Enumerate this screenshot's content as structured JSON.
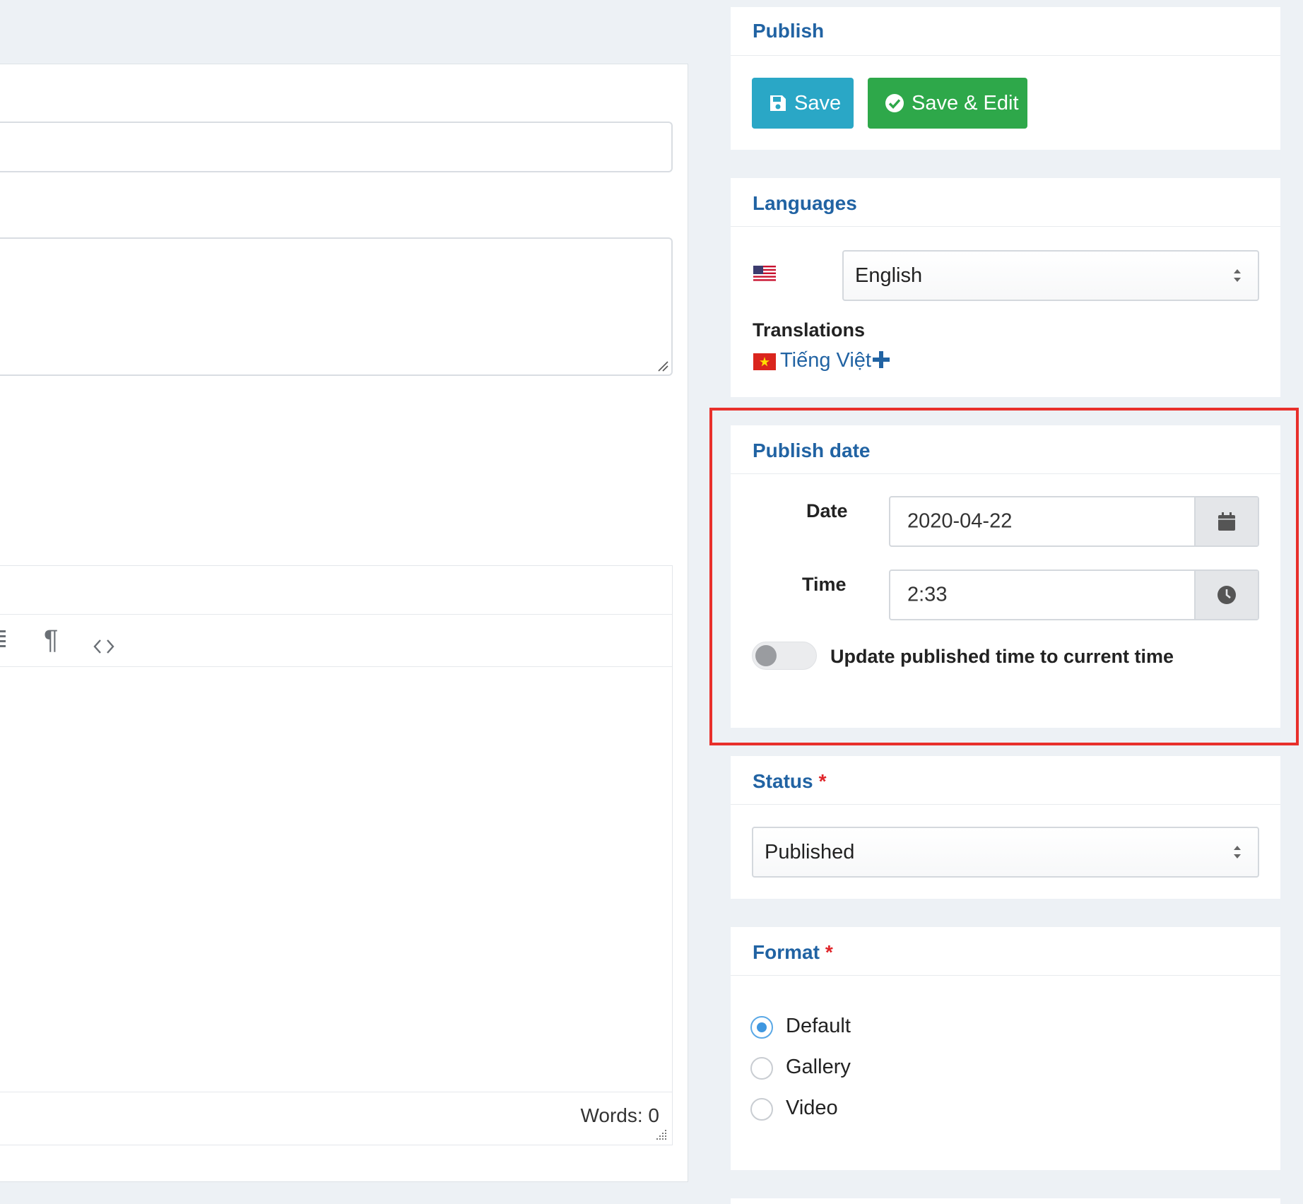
{
  "editor": {
    "word_count": "Words: 0",
    "toolbar_icons": [
      "align-justify-icon",
      "paragraph-icon",
      "code-icon"
    ]
  },
  "publish": {
    "title": "Publish",
    "save_label": "Save",
    "save_edit_label": "Save & Edit"
  },
  "languages": {
    "title": "Languages",
    "selected": "English",
    "translations_label": "Translations",
    "translation_link": "Tiếng Việt"
  },
  "publish_date": {
    "title": "Publish date",
    "date_label": "Date",
    "date_value": "2020-04-22",
    "time_label": "Time",
    "time_value": "2:33",
    "toggle_label": "Update published time to current time",
    "toggle_on": false
  },
  "status": {
    "title": "Status",
    "required": "*",
    "selected": "Published"
  },
  "format": {
    "title": "Format",
    "required": "*",
    "options": [
      {
        "label": "Default",
        "checked": true
      },
      {
        "label": "Gallery",
        "checked": false
      },
      {
        "label": "Video",
        "checked": false
      }
    ]
  },
  "colors": {
    "accent": "#2163a3",
    "save": "#2aa7c6",
    "save_edit": "#2ea84a",
    "highlight": "#e8302b",
    "required": "#e0252a"
  }
}
